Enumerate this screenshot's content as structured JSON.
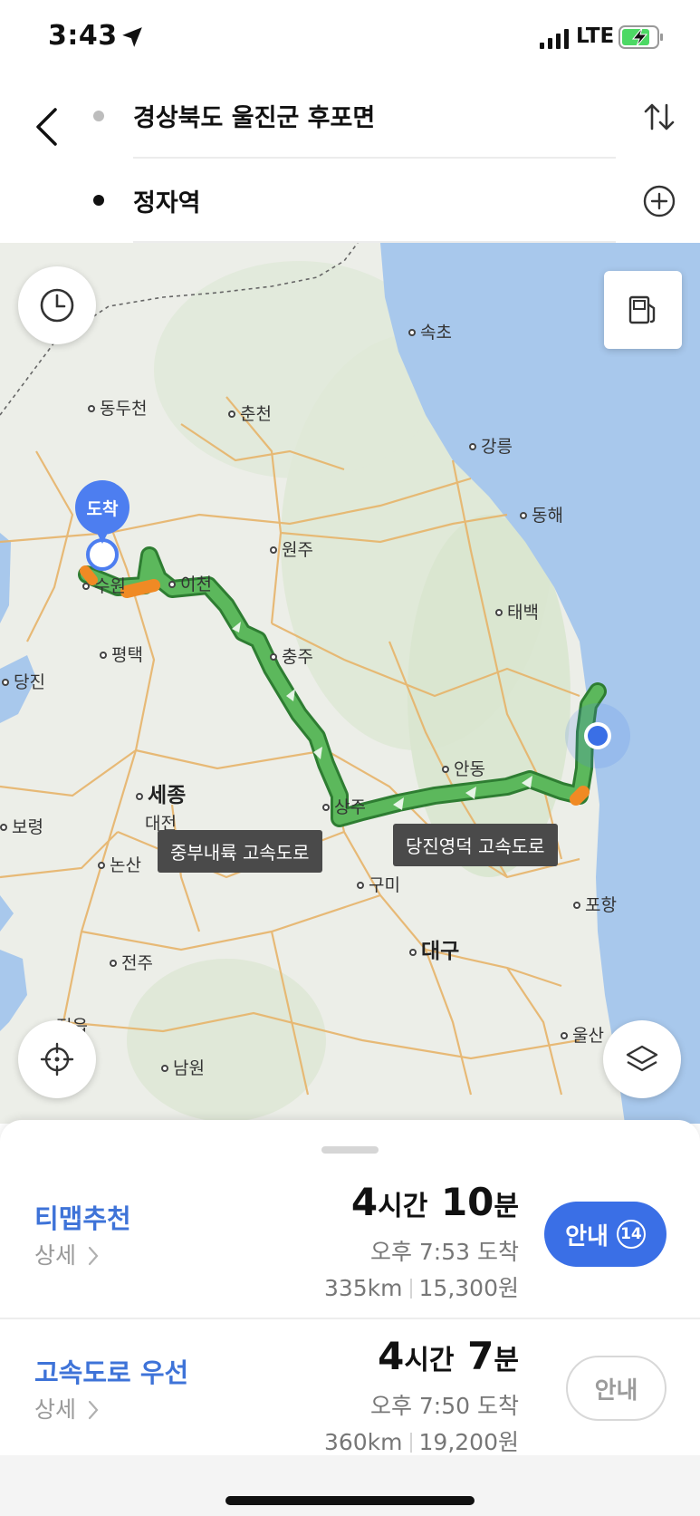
{
  "status_bar": {
    "time": "3:43",
    "network": "LTE"
  },
  "route": {
    "origin": "경상북도 울진군 후포면",
    "destination": "정자역"
  },
  "map": {
    "arrive_pin": "도착",
    "cities": {
      "sokcho": "속초",
      "dongducheon": "동두천",
      "chuncheon": "춘천",
      "gangneung": "강릉",
      "donghae": "동해",
      "wonju": "원주",
      "suwon": "수원",
      "icheon": "이천",
      "taebaek": "태백",
      "pyeongtaek": "평택",
      "chungju": "충주",
      "dangjin": "당진",
      "andong": "안동",
      "sejong": "세종",
      "daejeon": "대전",
      "sangju": "상주",
      "boryeong": "보령",
      "nonsan": "논산",
      "gumi": "구미",
      "pohang": "포항",
      "daegu": "대구",
      "jeonju": "전주",
      "ulsan": "울산",
      "jeongeup": "정읍",
      "namwon": "남원"
    },
    "road_labels": {
      "jungbu_naeryuk": "중부내륙 고속도로",
      "dangjin_yeongdeok": "당진영덕 고속도로"
    },
    "colors": {
      "route_green": "#4caf50",
      "route_orange": "#f39c34",
      "sea": "#a8c8ec",
      "pin_blue": "#4d7ef0"
    }
  },
  "options": [
    {
      "title": "티맵추천",
      "detail": "상세",
      "time_hours": "4",
      "time_hours_unit": "시간",
      "time_minutes": "10",
      "time_minutes_unit": "분",
      "arrival": "오후 7:53 도착",
      "distance": "335km",
      "toll": "15,300원",
      "guide_label": "안내",
      "guide_badge": "14"
    },
    {
      "title": "고속도로 우선",
      "detail": "상세",
      "time_hours": "4",
      "time_hours_unit": "시간",
      "time_minutes": "7",
      "time_minutes_unit": "분",
      "arrival": "오후 7:50 도착",
      "distance": "360km",
      "toll": "19,200원",
      "guide_label": "안내"
    }
  ]
}
